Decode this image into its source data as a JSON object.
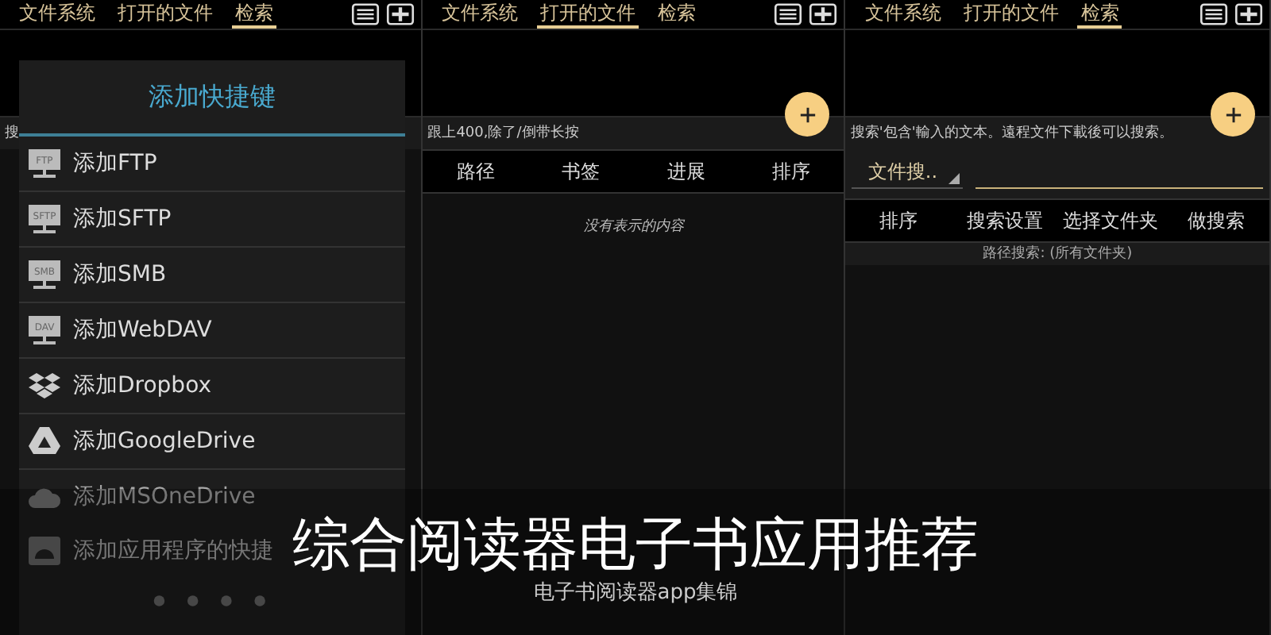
{
  "panels": [
    {
      "kind": "search_behind",
      "tabs": [
        {
          "label": "文件系统",
          "selected": false
        },
        {
          "label": "打开的文件",
          "selected": false
        },
        {
          "label": "检索",
          "selected": true
        }
      ],
      "hint": "搜"
    },
    {
      "kind": "open_files",
      "tabs": [
        {
          "label": "文件系统",
          "selected": false
        },
        {
          "label": "打开的文件",
          "selected": true
        },
        {
          "label": "检索",
          "selected": false
        }
      ],
      "hint": "跟上400,除了/倒带长按",
      "columns": [
        "路径",
        "书签",
        "进展",
        "排序"
      ],
      "empty": "没有表示的内容"
    },
    {
      "kind": "search",
      "tabs": [
        {
          "label": "文件系统",
          "selected": false
        },
        {
          "label": "打开的文件",
          "selected": false
        },
        {
          "label": "检索",
          "selected": true
        }
      ],
      "hint": "搜索'包含'輸入的文本。遠程文件下載後可以搜索。",
      "dropdown": "文件搜..",
      "buttons": [
        "排序",
        "搜索设置",
        "选择文件夹",
        "做搜索"
      ],
      "status": "路径搜索: (所有文件夹)"
    }
  ],
  "dialog": {
    "title": "添加快捷键",
    "items": [
      {
        "kind": "monitor",
        "icon_label": "FTP",
        "label": "添加FTP",
        "disabled": false
      },
      {
        "kind": "monitor",
        "icon_label": "SFTP",
        "label": "添加SFTP",
        "disabled": false
      },
      {
        "kind": "monitor",
        "icon_label": "SMB",
        "label": "添加SMB",
        "disabled": false
      },
      {
        "kind": "monitor",
        "icon_label": "DAV",
        "label": "添加WebDAV",
        "disabled": false
      },
      {
        "kind": "dropbox",
        "label": "添加Dropbox",
        "disabled": false
      },
      {
        "kind": "drive",
        "label": "添加GoogleDrive",
        "disabled": false
      },
      {
        "kind": "cloud",
        "label": "添加MSOneDrive",
        "disabled": true
      },
      {
        "kind": "android",
        "label": "添加应用程序的快捷",
        "disabled": true
      }
    ]
  },
  "caption": {
    "title": "综合阅读器电子书应用推荐",
    "subtitle": "电子书阅读器app集锦"
  }
}
